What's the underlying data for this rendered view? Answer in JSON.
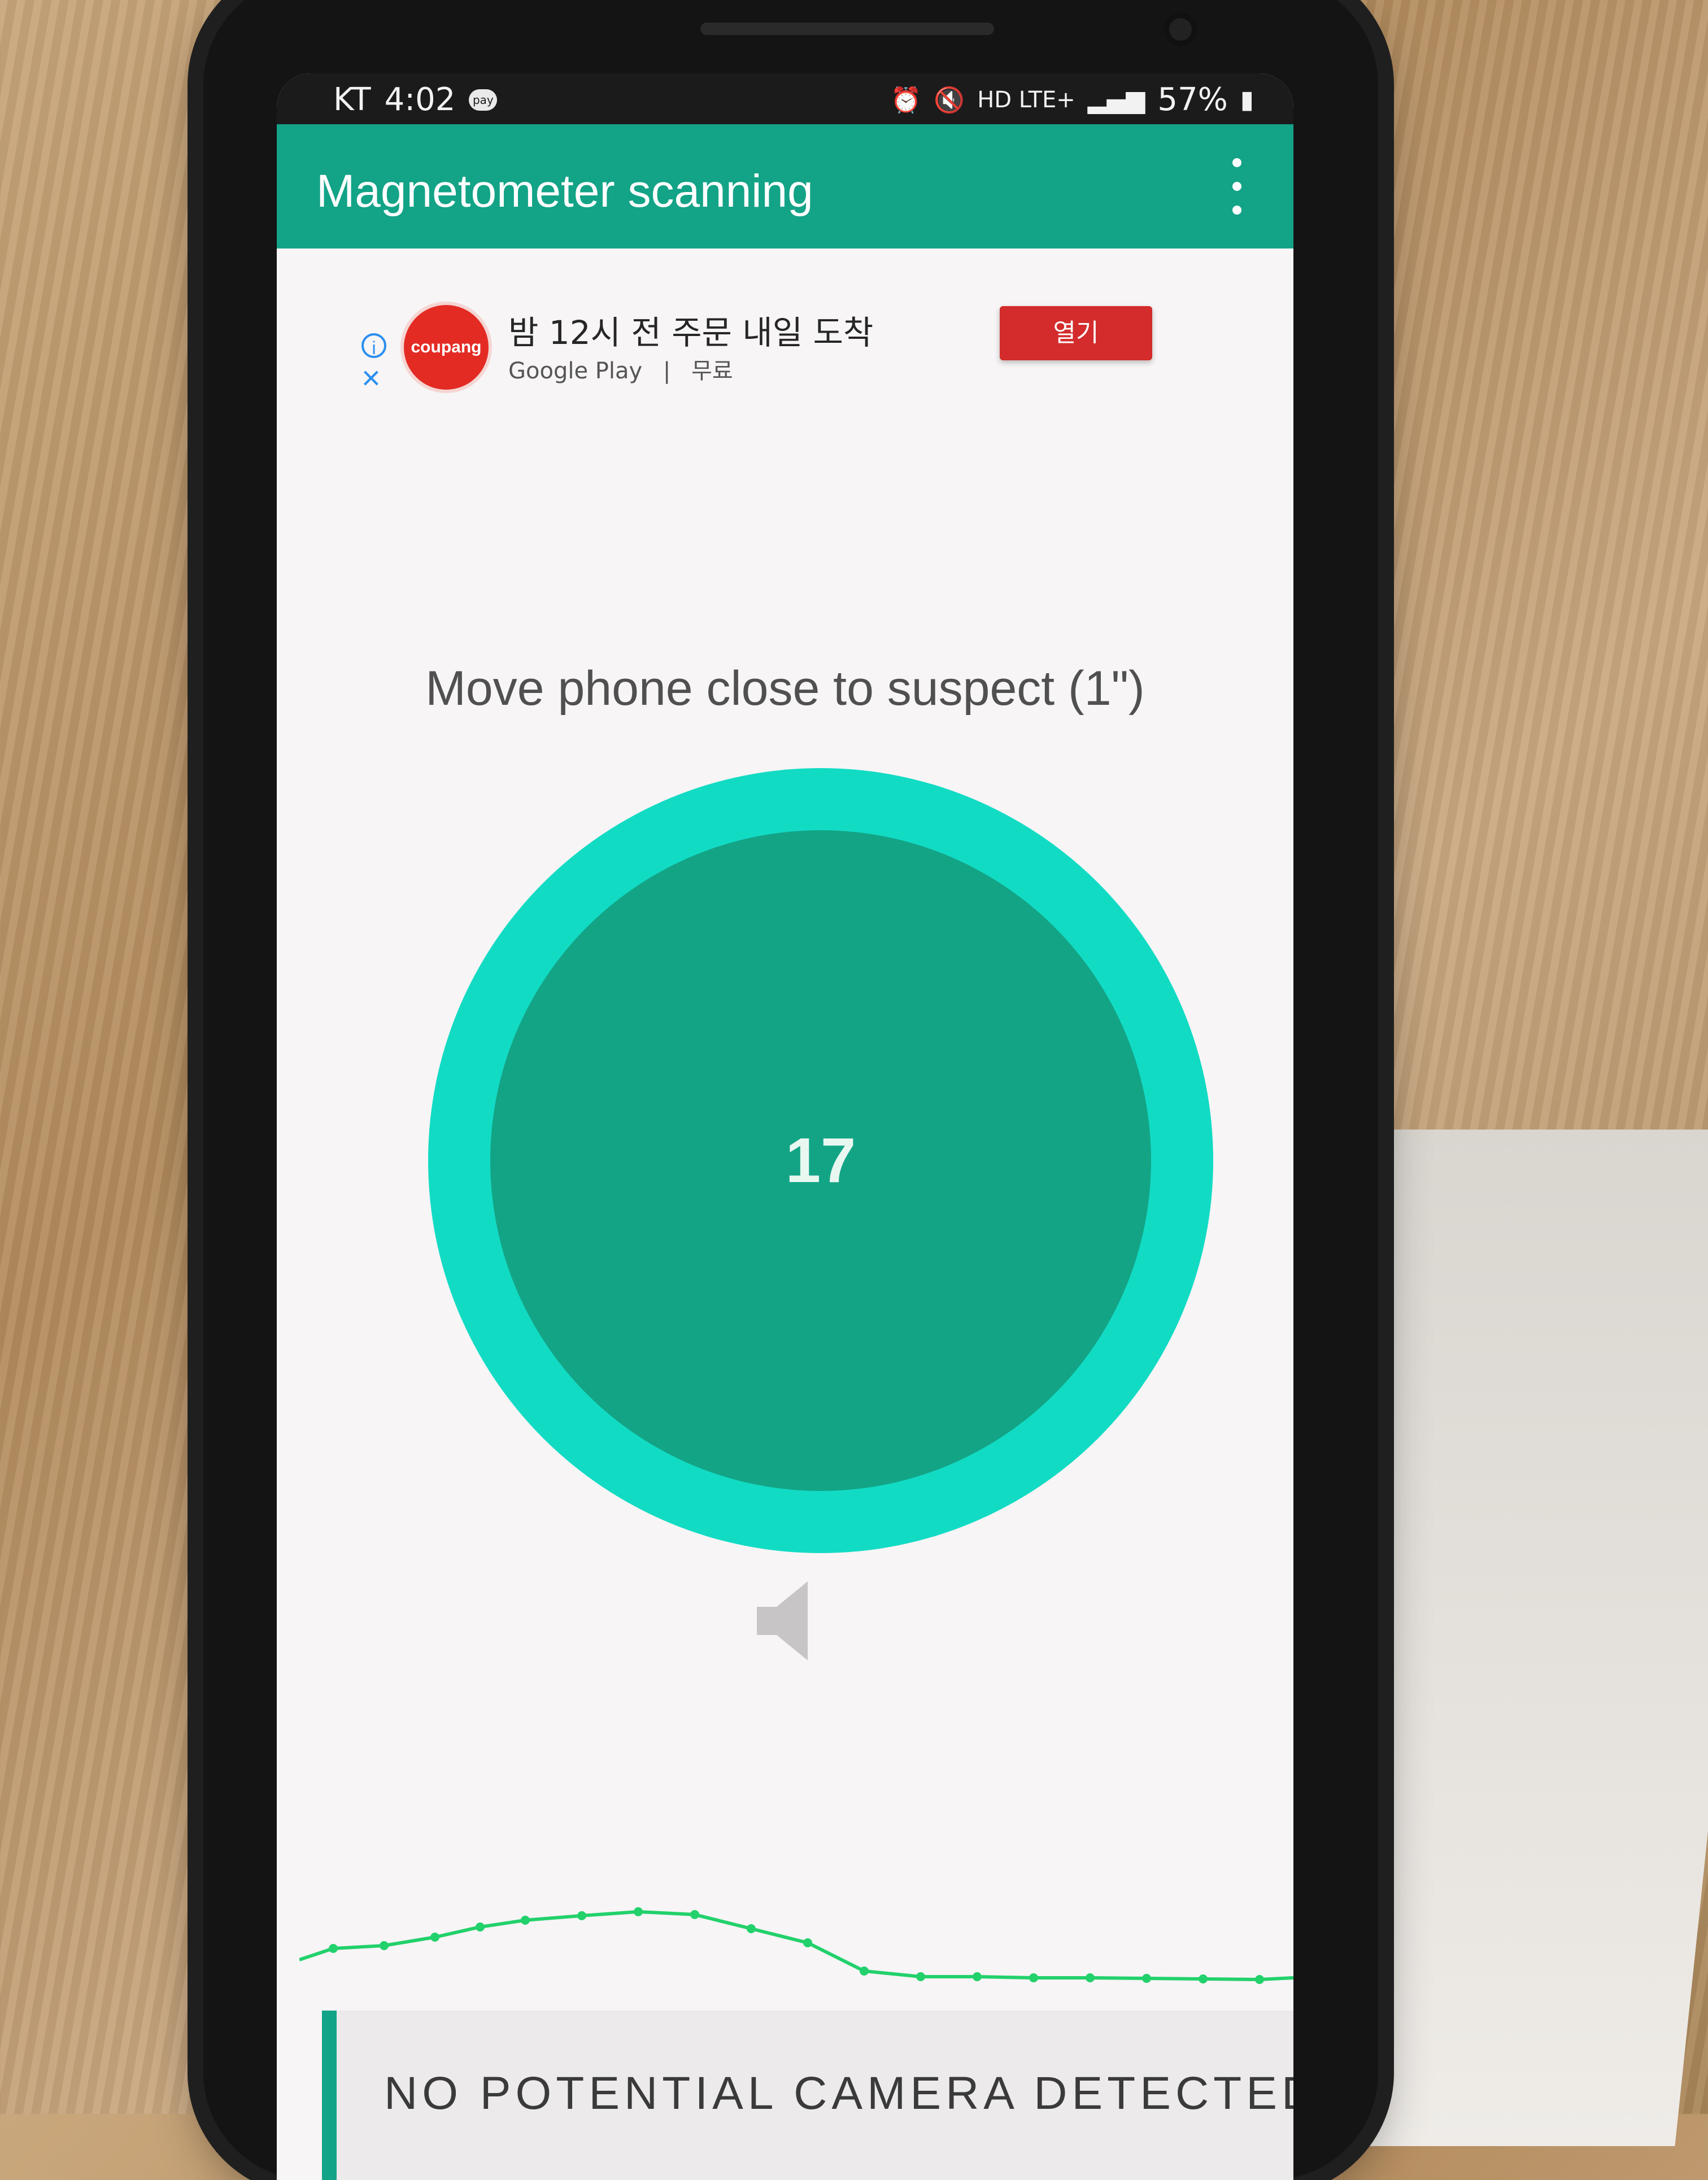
{
  "status_bar": {
    "carrier": "KT",
    "time": "4:02",
    "pay_badge": "pay",
    "network": "HD LTE+",
    "battery": "57%",
    "icons": [
      "alarm-icon",
      "mute-icon",
      "hd-voice-icon",
      "lte-icon",
      "signal-icon",
      "battery-icon"
    ]
  },
  "app_bar": {
    "title": "Magnetometer scanning",
    "menu_icon": "more-vert-icon"
  },
  "ad": {
    "brand": "coupang",
    "headline": "밤 12시 전 주문 내일 도착",
    "store": "Google Play",
    "separator": "|",
    "price": "무료",
    "open_button": "열기",
    "info_icon": "info-icon",
    "close_icon": "close-icon"
  },
  "main": {
    "instruction": "Move phone close to suspect (1\")",
    "gauge_value": "17",
    "speaker_icon": "speaker-icon"
  },
  "graph": {
    "series_color": "#22d16b"
  },
  "result": {
    "text": "NO POTENTIAL CAMERA DETECTED"
  },
  "colors": {
    "primary": "#13a387",
    "gauge_ring": "#12dbc4",
    "gauge_fill": "#13a486",
    "ad_button": "#d42c2c"
  }
}
